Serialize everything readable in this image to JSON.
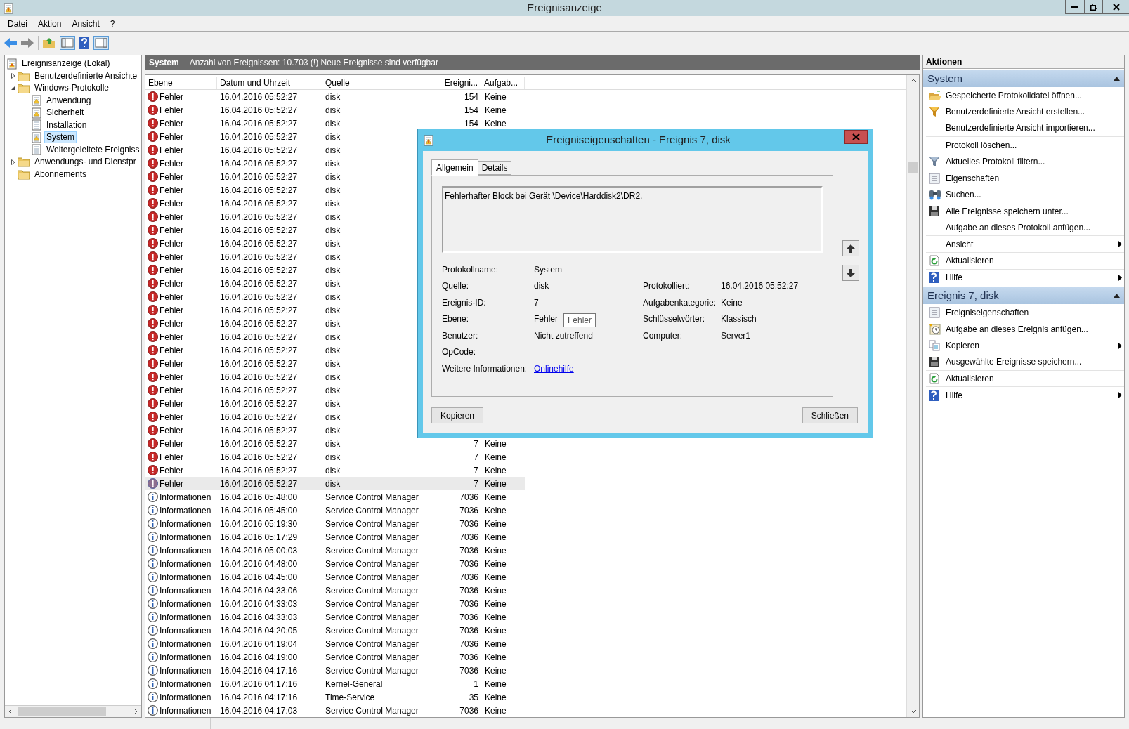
{
  "window": {
    "title": "Ereignisanzeige"
  },
  "menu": [
    "Datei",
    "Aktion",
    "Ansicht",
    "?"
  ],
  "tree": [
    {
      "label": "Ereignisanzeige (Lokal)",
      "children": [
        {
          "label": "Benutzerdefinierte Ansichte",
          "expanded": false,
          "selected": false
        },
        {
          "label": "Windows-Protokolle",
          "expanded": true,
          "selected": false,
          "children": [
            {
              "label": "Anwendung",
              "selected": false
            },
            {
              "label": "Sicherheit",
              "selected": false
            },
            {
              "label": "Installation",
              "selected": false
            },
            {
              "label": "System",
              "selected": true
            },
            {
              "label": "Weitergeleitete Ereigniss",
              "selected": false
            }
          ]
        },
        {
          "label": "Anwendungs- und Dienstpr",
          "expanded": false,
          "selected": false
        },
        {
          "label": "Abonnements",
          "selected": false
        }
      ],
      "selected": false
    }
  ],
  "log_header": {
    "title": "System",
    "info": "Anzahl von Ereignissen: 10.703 (!) Neue Ereignisse sind verfügbar"
  },
  "table": {
    "columns": [
      "Ebene",
      "Datum und Uhrzeit",
      "Quelle",
      "Ereigni...",
      "Aufgab..."
    ],
    "rows": [
      {
        "kind": "error",
        "level": "Fehler",
        "date": "16.04.2016 05:52:27",
        "source": "disk",
        "id": "154",
        "task": "Keine",
        "selected": false
      },
      {
        "kind": "error",
        "level": "Fehler",
        "date": "16.04.2016 05:52:27",
        "source": "disk",
        "id": "154",
        "task": "Keine",
        "selected": false
      },
      {
        "kind": "error",
        "level": "Fehler",
        "date": "16.04.2016 05:52:27",
        "source": "disk",
        "id": "154",
        "task": "Keine",
        "selected": false
      },
      {
        "kind": "error",
        "level": "Fehler",
        "date": "16.04.2016 05:52:27",
        "source": "disk",
        "selected": false
      },
      {
        "kind": "error",
        "level": "Fehler",
        "date": "16.04.2016 05:52:27",
        "source": "disk",
        "selected": false
      },
      {
        "kind": "error",
        "level": "Fehler",
        "date": "16.04.2016 05:52:27",
        "source": "disk",
        "selected": false
      },
      {
        "kind": "error",
        "level": "Fehler",
        "date": "16.04.2016 05:52:27",
        "source": "disk",
        "selected": false
      },
      {
        "kind": "error",
        "level": "Fehler",
        "date": "16.04.2016 05:52:27",
        "source": "disk",
        "selected": false
      },
      {
        "kind": "error",
        "level": "Fehler",
        "date": "16.04.2016 05:52:27",
        "source": "disk",
        "selected": false
      },
      {
        "kind": "error",
        "level": "Fehler",
        "date": "16.04.2016 05:52:27",
        "source": "disk",
        "selected": false
      },
      {
        "kind": "error",
        "level": "Fehler",
        "date": "16.04.2016 05:52:27",
        "source": "disk",
        "selected": false
      },
      {
        "kind": "error",
        "level": "Fehler",
        "date": "16.04.2016 05:52:27",
        "source": "disk",
        "selected": false
      },
      {
        "kind": "error",
        "level": "Fehler",
        "date": "16.04.2016 05:52:27",
        "source": "disk",
        "selected": false
      },
      {
        "kind": "error",
        "level": "Fehler",
        "date": "16.04.2016 05:52:27",
        "source": "disk",
        "selected": false
      },
      {
        "kind": "error",
        "level": "Fehler",
        "date": "16.04.2016 05:52:27",
        "source": "disk",
        "selected": false
      },
      {
        "kind": "error",
        "level": "Fehler",
        "date": "16.04.2016 05:52:27",
        "source": "disk",
        "selected": false
      },
      {
        "kind": "error",
        "level": "Fehler",
        "date": "16.04.2016 05:52:27",
        "source": "disk",
        "selected": false
      },
      {
        "kind": "error",
        "level": "Fehler",
        "date": "16.04.2016 05:52:27",
        "source": "disk",
        "selected": false
      },
      {
        "kind": "error",
        "level": "Fehler",
        "date": "16.04.2016 05:52:27",
        "source": "disk",
        "selected": false
      },
      {
        "kind": "error",
        "level": "Fehler",
        "date": "16.04.2016 05:52:27",
        "source": "disk",
        "selected": false
      },
      {
        "kind": "error",
        "level": "Fehler",
        "date": "16.04.2016 05:52:27",
        "source": "disk",
        "selected": false
      },
      {
        "kind": "error",
        "level": "Fehler",
        "date": "16.04.2016 05:52:27",
        "source": "disk",
        "selected": false
      },
      {
        "kind": "error",
        "level": "Fehler",
        "date": "16.04.2016 05:52:27",
        "source": "disk",
        "selected": false
      },
      {
        "kind": "error",
        "level": "Fehler",
        "date": "16.04.2016 05:52:27",
        "source": "disk",
        "selected": false
      },
      {
        "kind": "error",
        "level": "Fehler",
        "date": "16.04.2016 05:52:27",
        "source": "disk",
        "selected": false
      },
      {
        "kind": "error",
        "level": "Fehler",
        "date": "16.04.2016 05:52:27",
        "source": "disk",
        "selected": false
      },
      {
        "kind": "error",
        "level": "Fehler",
        "date": "16.04.2016 05:52:27",
        "source": "disk",
        "id": "7",
        "task": "Keine",
        "selected": false
      },
      {
        "kind": "error",
        "level": "Fehler",
        "date": "16.04.2016 05:52:27",
        "source": "disk",
        "id": "7",
        "task": "Keine",
        "selected": false
      },
      {
        "kind": "error",
        "level": "Fehler",
        "date": "16.04.2016 05:52:27",
        "source": "disk",
        "id": "7",
        "task": "Keine",
        "selected": false
      },
      {
        "kind": "error",
        "level": "Fehler",
        "date": "16.04.2016 05:52:27",
        "source": "disk",
        "id": "7",
        "task": "Keine",
        "selected": true
      },
      {
        "kind": "info",
        "level": "Informationen",
        "date": "16.04.2016 05:48:00",
        "source": "Service Control Manager",
        "id": "7036",
        "task": "Keine",
        "selected": false
      },
      {
        "kind": "info",
        "level": "Informationen",
        "date": "16.04.2016 05:45:00",
        "source": "Service Control Manager",
        "id": "7036",
        "task": "Keine",
        "selected": false
      },
      {
        "kind": "info",
        "level": "Informationen",
        "date": "16.04.2016 05:19:30",
        "source": "Service Control Manager",
        "id": "7036",
        "task": "Keine",
        "selected": false
      },
      {
        "kind": "info",
        "level": "Informationen",
        "date": "16.04.2016 05:17:29",
        "source": "Service Control Manager",
        "id": "7036",
        "task": "Keine",
        "selected": false
      },
      {
        "kind": "info",
        "level": "Informationen",
        "date": "16.04.2016 05:00:03",
        "source": "Service Control Manager",
        "id": "7036",
        "task": "Keine",
        "selected": false
      },
      {
        "kind": "info",
        "level": "Informationen",
        "date": "16.04.2016 04:48:00",
        "source": "Service Control Manager",
        "id": "7036",
        "task": "Keine",
        "selected": false
      },
      {
        "kind": "info",
        "level": "Informationen",
        "date": "16.04.2016 04:45:00",
        "source": "Service Control Manager",
        "id": "7036",
        "task": "Keine",
        "selected": false
      },
      {
        "kind": "info",
        "level": "Informationen",
        "date": "16.04.2016 04:33:06",
        "source": "Service Control Manager",
        "id": "7036",
        "task": "Keine",
        "selected": false
      },
      {
        "kind": "info",
        "level": "Informationen",
        "date": "16.04.2016 04:33:03",
        "source": "Service Control Manager",
        "id": "7036",
        "task": "Keine",
        "selected": false
      },
      {
        "kind": "info",
        "level": "Informationen",
        "date": "16.04.2016 04:33:03",
        "source": "Service Control Manager",
        "id": "7036",
        "task": "Keine",
        "selected": false
      },
      {
        "kind": "info",
        "level": "Informationen",
        "date": "16.04.2016 04:20:05",
        "source": "Service Control Manager",
        "id": "7036",
        "task": "Keine",
        "selected": false
      },
      {
        "kind": "info",
        "level": "Informationen",
        "date": "16.04.2016 04:19:04",
        "source": "Service Control Manager",
        "id": "7036",
        "task": "Keine",
        "selected": false
      },
      {
        "kind": "info",
        "level": "Informationen",
        "date": "16.04.2016 04:19:00",
        "source": "Service Control Manager",
        "id": "7036",
        "task": "Keine",
        "selected": false
      },
      {
        "kind": "info",
        "level": "Informationen",
        "date": "16.04.2016 04:17:16",
        "source": "Service Control Manager",
        "id": "7036",
        "task": "Keine",
        "selected": false
      },
      {
        "kind": "info",
        "level": "Informationen",
        "date": "16.04.2016 04:17:16",
        "source": "Kernel-General",
        "id": "1",
        "task": "Keine",
        "selected": false
      },
      {
        "kind": "info",
        "level": "Informationen",
        "date": "16.04.2016 04:17:16",
        "source": "Time-Service",
        "id": "35",
        "task": "Keine",
        "selected": false
      },
      {
        "kind": "info",
        "level": "Informationen",
        "date": "16.04.2016 04:17:03",
        "source": "Service Control Manager",
        "id": "7036",
        "task": "Keine",
        "selected": false
      }
    ]
  },
  "actions": {
    "title": "Aktionen",
    "sections": [
      {
        "title": "System",
        "items": [
          {
            "label": "Gespeicherte Protokolldatei öffnen...",
            "submenu": false
          },
          {
            "label": "Benutzerdefinierte Ansicht erstellen...",
            "submenu": false
          },
          {
            "label": "Benutzerdefinierte Ansicht importieren...",
            "submenu": false
          },
          {
            "label": "Protokoll löschen...",
            "submenu": false
          },
          {
            "label": "Aktuelles Protokoll filtern...",
            "submenu": false
          },
          {
            "label": "Eigenschaften",
            "submenu": false
          },
          {
            "label": "Suchen...",
            "submenu": false
          },
          {
            "label": "Alle Ereignisse speichern unter...",
            "submenu": false
          },
          {
            "label": "Aufgabe an dieses Protokoll anfügen...",
            "submenu": false
          },
          {
            "label": "Ansicht",
            "submenu": true
          },
          {
            "label": "Aktualisieren",
            "submenu": false
          },
          {
            "label": "Hilfe",
            "submenu": true
          }
        ]
      },
      {
        "title": "Ereignis 7, disk",
        "items": [
          {
            "label": "Ereigniseigenschaften",
            "submenu": false
          },
          {
            "label": "Aufgabe an dieses Ereignis anfügen...",
            "submenu": false
          },
          {
            "label": "Kopieren",
            "submenu": true
          },
          {
            "label": "Ausgewählte Ereignisse speichern...",
            "submenu": false
          },
          {
            "label": "Aktualisieren",
            "submenu": false
          },
          {
            "label": "Hilfe",
            "submenu": true
          }
        ]
      }
    ]
  },
  "dialog": {
    "title": "Ereigniseigenschaften - Ereignis 7, disk",
    "tabs": [
      {
        "label": "Allgemein",
        "selected": true
      },
      {
        "label": "Details",
        "selected": false
      }
    ],
    "description": "Fehlerhafter Block bei Gerät \\Device\\Harddisk2\\DR2.",
    "fields_left": [
      {
        "label": "Protokollname:",
        "value": "System"
      },
      {
        "label": "Quelle:",
        "value": "disk"
      },
      {
        "label": "Ereignis-ID:",
        "value": "7"
      },
      {
        "label": "Ebene:",
        "value": "Fehler"
      },
      {
        "label": "Benutzer:",
        "value": "Nicht zutreffend"
      },
      {
        "label": "OpCode:"
      },
      {
        "label": "Weitere Informationen:",
        "value": "Onlinehilfe",
        "kind": "link"
      }
    ],
    "fields_right": [
      {
        "label": "Protokolliert:",
        "value": "16.04.2016 05:52:27"
      },
      {
        "label": "Aufgabenkategorie:",
        "value": "Keine"
      },
      {
        "label": "Schlüsselwörter:",
        "value": "Klassisch"
      },
      {
        "label": "Computer:",
        "value": "Server1"
      }
    ],
    "tooltip": "Fehler",
    "buttons": [
      "Kopieren",
      "Schließen"
    ]
  }
}
